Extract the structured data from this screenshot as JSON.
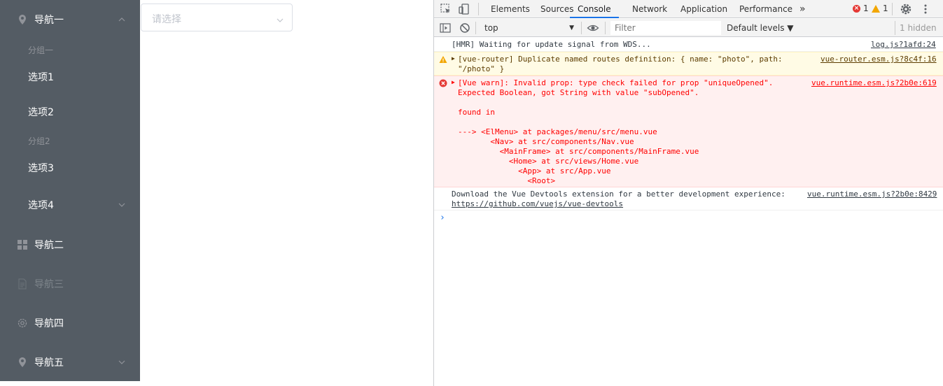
{
  "sidebar": {
    "nav1": "导航一",
    "group1": "分组一",
    "option1": "选项1",
    "option2": "选项2",
    "group2": "分组2",
    "option3": "选项3",
    "option4": "选项4",
    "nav2": "导航二",
    "nav3": "导航三",
    "nav4": "导航四",
    "nav5": "导航五",
    "colors": {
      "background": "#545c64",
      "text": "#ffffff",
      "disabled": "#7e858b",
      "group": "#909399"
    }
  },
  "select": {
    "placeholder": "请选择"
  },
  "devtools": {
    "tabs": [
      "Elements",
      "Sources",
      "Console",
      "Network",
      "Application",
      "Performance"
    ],
    "active_tab": "Console",
    "more": "»",
    "error_count": "1",
    "warning_count": "1",
    "context": "top",
    "filter_placeholder": "Filter",
    "levels": "Default levels ▼",
    "hidden": "1 hidden",
    "messages": [
      {
        "level": "log",
        "text": "[HMR] Waiting for update signal from WDS...",
        "source": "log.js?1afd:24"
      },
      {
        "level": "warning",
        "text": "[vue-router] Duplicate named routes definition: { name: \"photo\", path:\n\"/photo\" }",
        "source": "vue-router.esm.js?8c4f:16"
      },
      {
        "level": "error",
        "text": "[Vue warn]: Invalid prop: type check failed for prop \"uniqueOpened\".\nExpected Boolean, got String with value \"subOpened\".\n\nfound in\n\n---> <ElMenu> at packages/menu/src/menu.vue\n       <Nav> at src/components/Nav.vue\n         <MainFrame> at src/components/MainFrame.vue\n           <Home> at src/views/Home.vue\n             <App> at src/App.vue\n               <Root>",
        "source": "vue.runtime.esm.js?2b0e:619"
      },
      {
        "level": "log",
        "text": "Download the Vue Devtools extension for a better development experience:",
        "link": "https://github.com/vuejs/vue-devtools",
        "source": "vue.runtime.esm.js?2b0e:8429"
      }
    ],
    "prompt": "›"
  }
}
